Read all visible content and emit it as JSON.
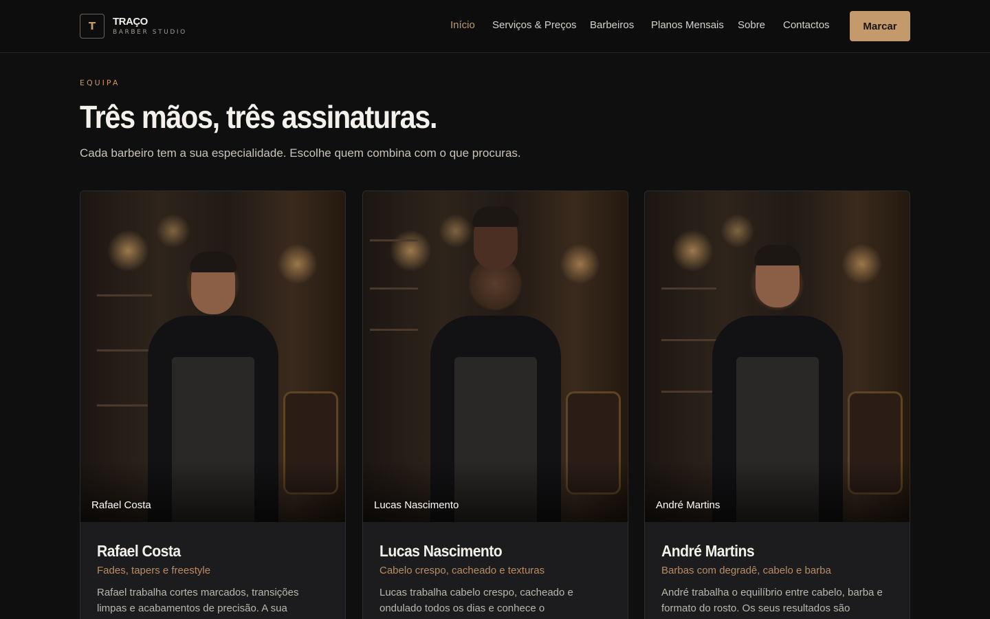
{
  "brand": {
    "mark": "T",
    "name": "TRAÇO",
    "tagline": "BARBER STUDIO"
  },
  "nav": {
    "items": [
      {
        "label": "Início",
        "active": true
      },
      {
        "label": "Serviços & Preços",
        "active": false
      },
      {
        "label": "Barbeiros",
        "active": false
      },
      {
        "label": "Planos Mensais",
        "active": false
      },
      {
        "label": "Sobre",
        "active": false
      },
      {
        "label": "Contactos",
        "active": false
      }
    ],
    "cta_label": "Marcar"
  },
  "section": {
    "eyebrow": "EQUIPA",
    "title": "Três mãos, três assinaturas.",
    "subtitle": "Cada barbeiro tem a sua especialidade. Escolhe quem combina com o que procuras."
  },
  "barbers": [
    {
      "photo_caption": "Rafael Costa",
      "name": "Rafael Costa",
      "specialty": "Fades, tapers e freestyle",
      "description": "Rafael trabalha cortes marcados, transições limpas e acabamentos de precisão. A sua abordagem"
    },
    {
      "photo_caption": "Lucas Nascimento",
      "name": "Lucas Nascimento",
      "specialty": "Cabelo crespo, cacheado e texturas",
      "description": "Lucas trabalha cabelo crespo, cacheado e ondulado todos os dias e conhece o comportamento de cada"
    },
    {
      "photo_caption": "André Martins",
      "name": "André Martins",
      "specialty": "Barbas com degradê, cabelo e barba",
      "description": "André trabalha o equilíbrio entre cabelo, barba e formato do rosto. Os seus resultados são cuidados,"
    }
  ],
  "colors": {
    "accent": "#c49a6c",
    "background": "#0f0f10",
    "card": "#1c1c1e"
  }
}
